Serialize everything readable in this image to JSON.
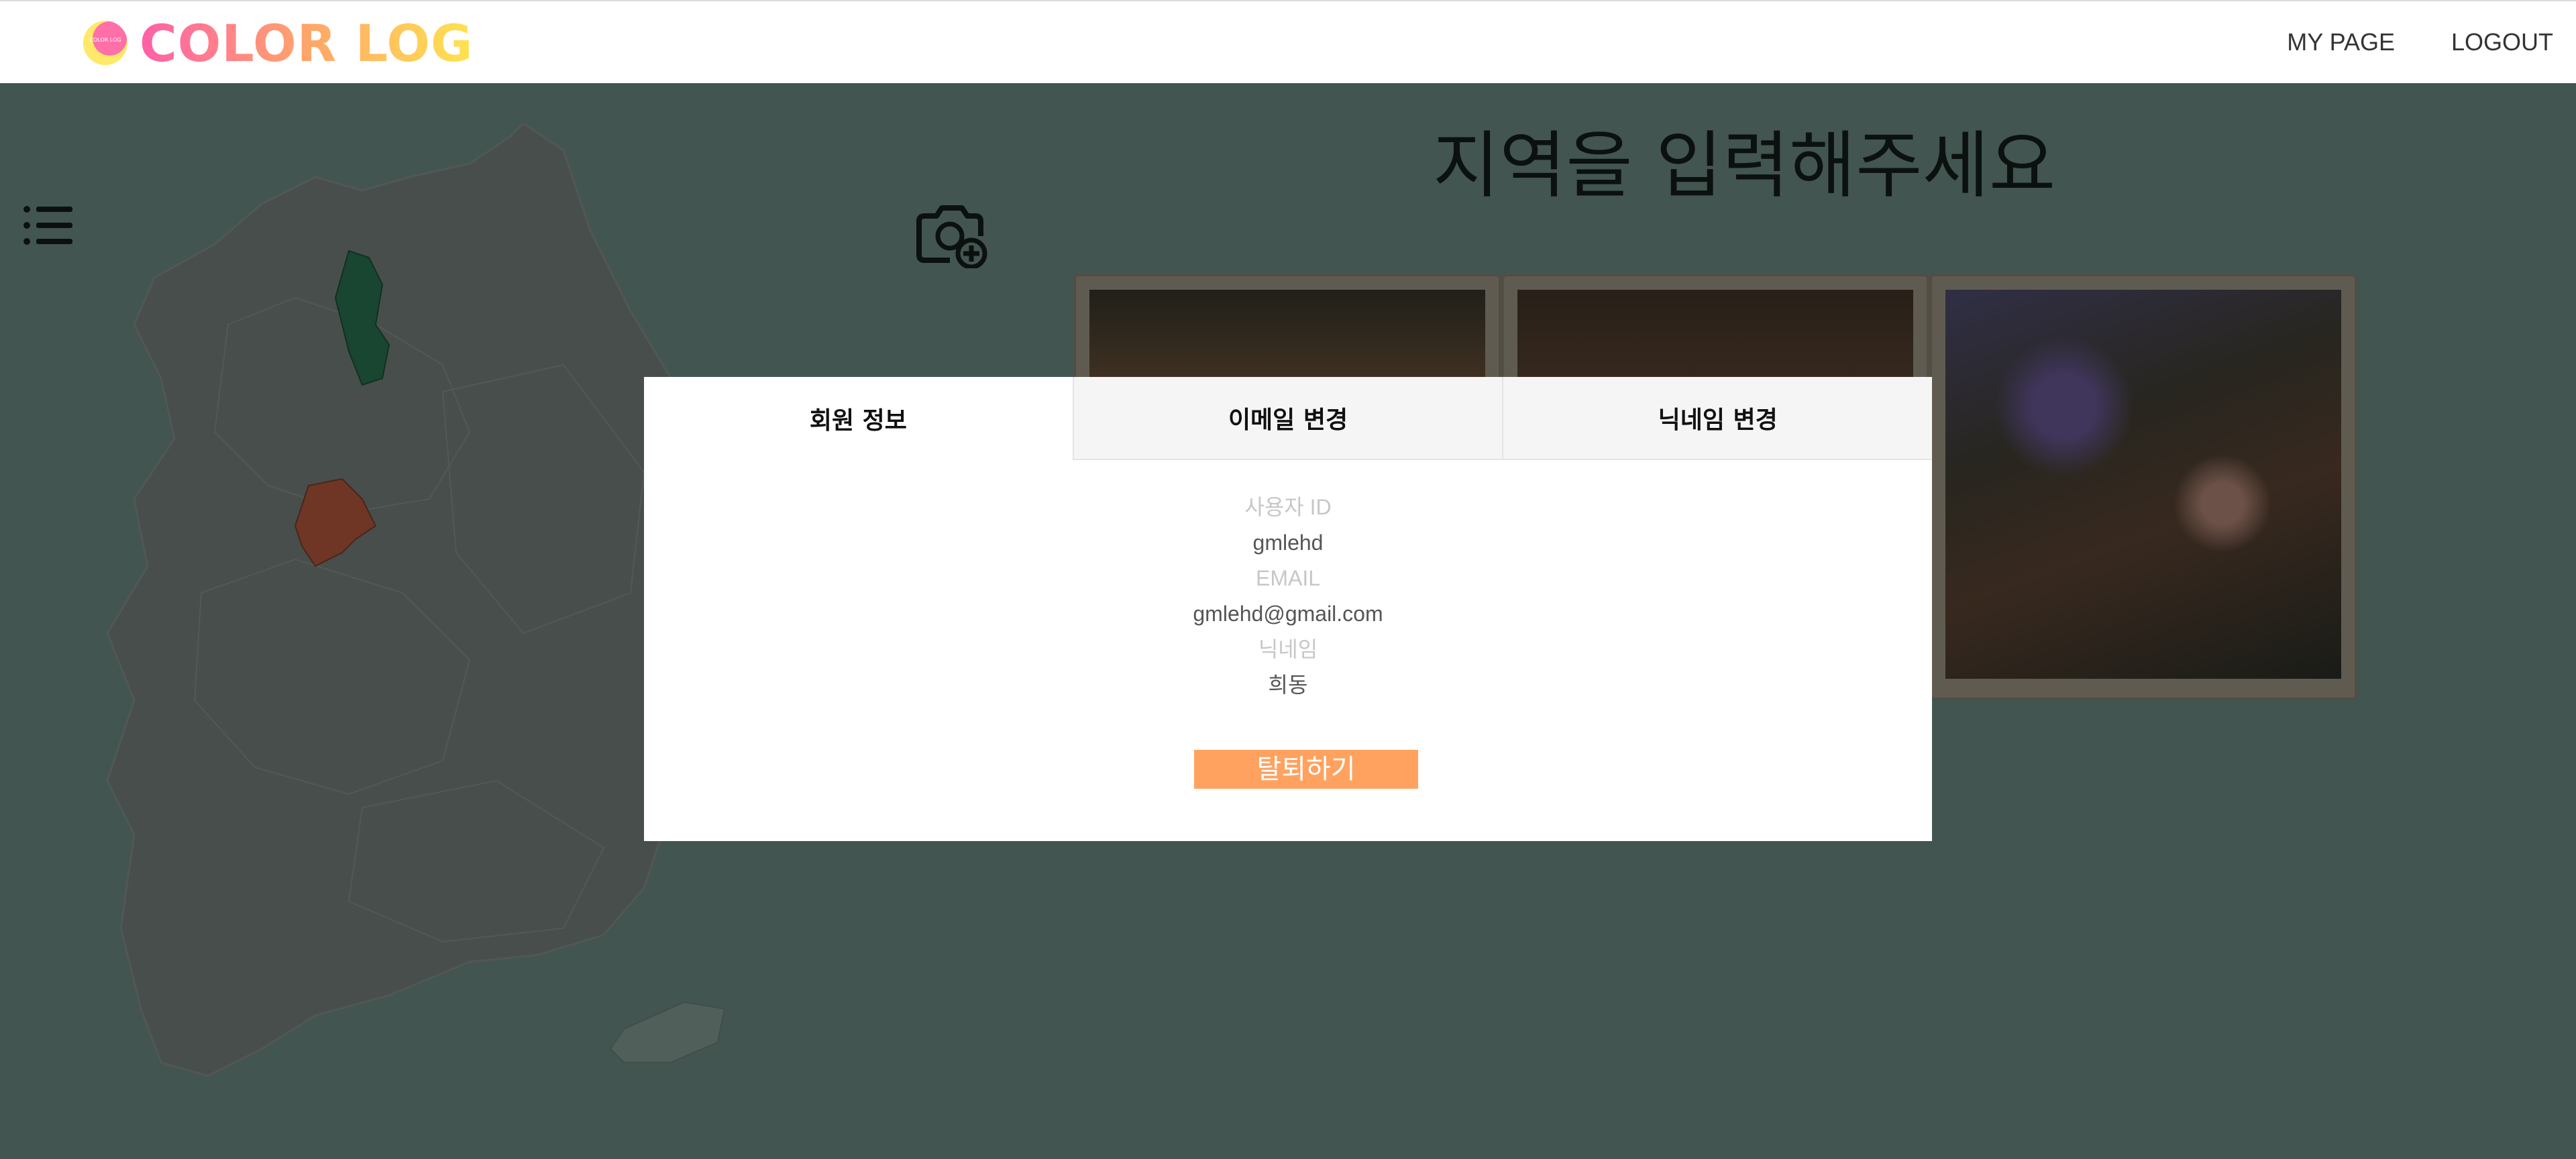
{
  "header": {
    "logo_text": "COLOR LOG",
    "logo_badge_text": "COLOR LOG",
    "nav": [
      {
        "label": "MY PAGE"
      },
      {
        "label": "LOGOUT"
      }
    ]
  },
  "main": {
    "heading": "지역을 입력해주세요",
    "menu_icon": "list-icon",
    "upload_icon": "camera-plus-icon",
    "map_icon": "korea-map"
  },
  "modal": {
    "tabs": [
      {
        "label": "회원 정보",
        "active": true
      },
      {
        "label": "이메일 변경",
        "active": false
      },
      {
        "label": "닉네임 변경",
        "active": false
      }
    ],
    "user_id_label": "사용자 ID",
    "user_id": "gmlehd",
    "email_label": "EMAIL",
    "email": "gmlehd@gmail.com",
    "nickname_label": "닉네임",
    "nickname": "희동",
    "withdraw_label": "탈퇴하기"
  },
  "colors": {
    "background": "#6f8983",
    "map_fill": "#7b7b7b",
    "highlight_green": "#1b6b43",
    "highlight_red": "#c84a2c",
    "withdraw_button": "#ffa25f"
  }
}
